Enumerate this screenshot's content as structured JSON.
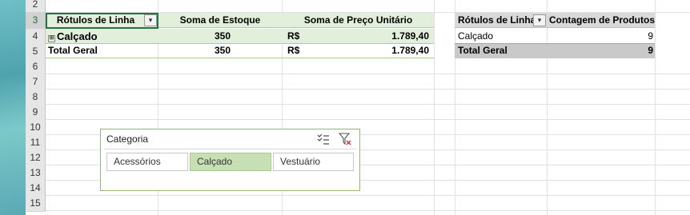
{
  "row_numbers": [
    "2",
    "3",
    "4",
    "5",
    "6",
    "7",
    "8",
    "9",
    "10",
    "11",
    "12",
    "13",
    "14",
    "15"
  ],
  "pivot1": {
    "headers": [
      "Rótulos de Linha",
      "Soma de Estoque",
      "Soma de Preço Unitário"
    ],
    "row": {
      "label": "Calçado",
      "estoque": "350",
      "currency": "R$",
      "preco": "1.789,40"
    },
    "total": {
      "label": "Total Geral",
      "estoque": "350",
      "currency": "R$",
      "preco": "1.789,40"
    }
  },
  "pivot2": {
    "headers": [
      "Rótulos de Linha",
      "Contagem de Produtos"
    ],
    "row": {
      "label": "Calçado",
      "count": "9"
    },
    "total": {
      "label": "Total Geral",
      "count": "9"
    }
  },
  "slicer": {
    "title": "Categoria",
    "items": [
      "Acessórios",
      "Calçado",
      "Vestuário"
    ],
    "selected": "Calçado"
  },
  "icons": {
    "filter_dropdown": "filter-dropdown-icon",
    "multi_select": "multi-select-icon",
    "clear_filter": "clear-filter-icon",
    "expand": "expand-icon"
  },
  "colors": {
    "accent": "#217346",
    "pivot_band": "#e2efda",
    "slicer_selected": "#c6e0b4",
    "grey_header": "#d9d9d9"
  }
}
